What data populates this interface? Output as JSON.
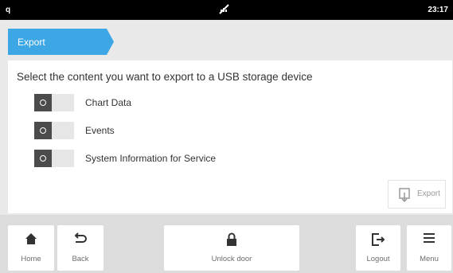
{
  "status": {
    "left": "q",
    "right": "23:17",
    "center_icon": "signal-off-icon"
  },
  "breadcrumb": {
    "label": "Export"
  },
  "main": {
    "heading": "Select the content you want to export to a USB storage device",
    "options": [
      {
        "label": "Chart Data",
        "state": "off"
      },
      {
        "label": "Events",
        "state": "off"
      },
      {
        "label": "System Information for Service",
        "state": "off"
      }
    ],
    "export_label": "Export"
  },
  "nav": {
    "home": "Home",
    "back": "Back",
    "unlock": "Unlock door",
    "logout": "Logout",
    "menu": "Menu"
  },
  "colors": {
    "accent": "#3da7e6",
    "toggle_knob": "#4b4b4b",
    "toggle_track": "#e6e6e6"
  }
}
